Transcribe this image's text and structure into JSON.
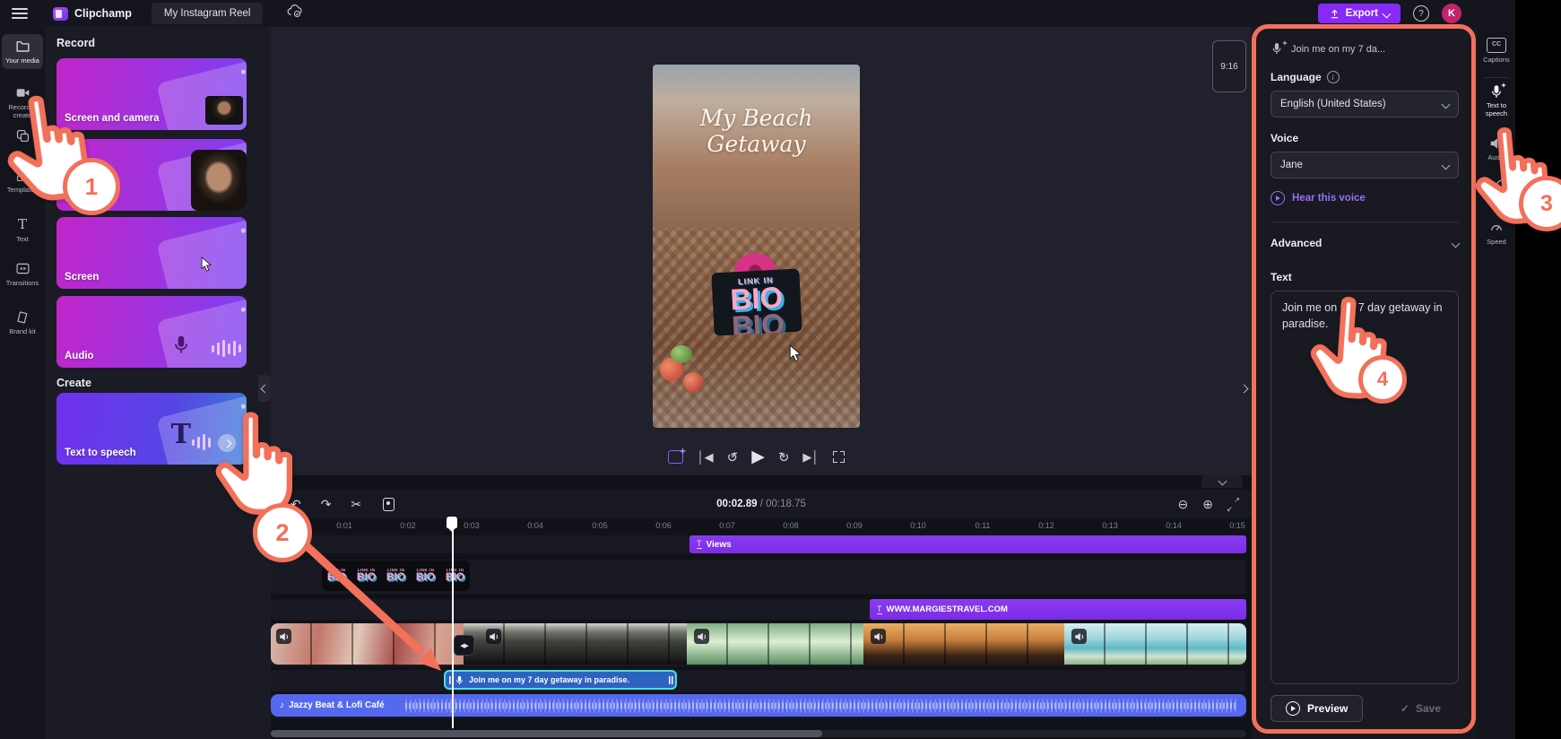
{
  "colors": {
    "accent_purple": "#8729f8",
    "annotation_coral": "#f3705a",
    "audio_blue": "#5569ee",
    "track_purple": "#7b2ce5",
    "speech_teal": "#49dfe8",
    "avatar_pink": "#c2236f"
  },
  "topbar": {
    "app_name": "Clipchamp",
    "project_title": "My Instagram Reel",
    "export_label": "Export",
    "help_glyph": "?",
    "avatar_initial": "K"
  },
  "left_rail": {
    "items": [
      {
        "label": "Your media"
      },
      {
        "label": "Record & create"
      },
      {
        "label": ""
      },
      {
        "label": "Templates"
      },
      {
        "label": "Text"
      },
      {
        "label": "Transitions"
      },
      {
        "label": "Brand kit"
      }
    ]
  },
  "record_panel": {
    "record_heading": "Record",
    "create_heading": "Create",
    "cards": [
      {
        "label": "Screen and camera"
      },
      {
        "label": "Camera"
      },
      {
        "label": "Screen"
      },
      {
        "label": "Audio"
      },
      {
        "label": "Text to speech"
      }
    ]
  },
  "preview": {
    "title_line1": "My Beach",
    "title_line2": "Getaway",
    "sticker_small": "LINK IN",
    "sticker_word": "BIO",
    "aspect_badge": "9:16"
  },
  "playback": {
    "current_time": "00:02.89",
    "total_time": "00:18.75"
  },
  "timeline": {
    "ruler": [
      "0:01",
      "0:02",
      "0:03",
      "0:04",
      "0:05",
      "0:06",
      "0:07",
      "0:08",
      "0:09",
      "0:10",
      "0:11",
      "0:12",
      "0:13",
      "0:14",
      "0:15"
    ],
    "views_label": "Views",
    "margies_label": "WWW.MARGIESTRAVEL.COM",
    "speech_label": "Join me on my 7 day getaway in paradise.",
    "audio_label": "Jazzy Beat & Lofi Café"
  },
  "right_panel": {
    "header": "Join me on my 7 da...",
    "language_label": "Language",
    "language_value": "English (United States)",
    "voice_label": "Voice",
    "voice_value": "Jane",
    "hear_voice_label": "Hear this voice",
    "advanced_label": "Advanced",
    "text_label": "Text",
    "text_value": "Join me on my 7 day getaway in paradise.",
    "preview_label": "Preview",
    "save_label": "Save"
  },
  "right_rail": {
    "items": [
      {
        "label": "Captions"
      },
      {
        "label": "Text to speech"
      },
      {
        "label": "Audio"
      },
      {
        "label": "Fade"
      },
      {
        "label": "Speed"
      }
    ]
  },
  "glyphs": {
    "captions": "CC",
    "text_tool": "T",
    "undo": "↶",
    "redo": "↷",
    "cut": "✂",
    "zoom_out": "⊖",
    "zoom_in": "⊕",
    "music_note": "♪",
    "check": "✓",
    "time_separator": "/",
    "info": "i"
  },
  "annotations": {
    "steps": [
      "1",
      "2",
      "3",
      "4"
    ]
  }
}
